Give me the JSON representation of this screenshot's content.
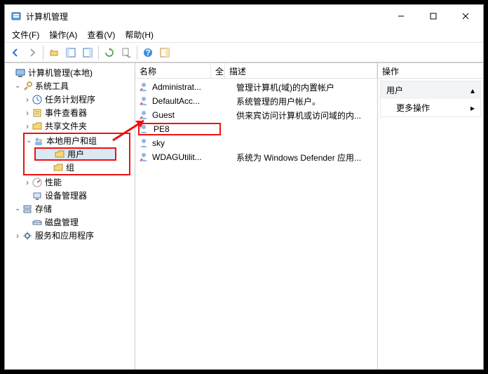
{
  "window": {
    "title": "计算机管理"
  },
  "menu": {
    "file": "文件(F)",
    "action": "操作(A)",
    "view": "查看(V)",
    "help": "帮助(H)"
  },
  "tree": {
    "root": "计算机管理(本地)",
    "system_tools": "系统工具",
    "task_scheduler": "任务计划程序",
    "event_viewer": "事件查看器",
    "shared_folders": "共享文件夹",
    "local_users_groups": "本地用户和组",
    "users": "用户",
    "groups": "组",
    "performance": "性能",
    "device_manager": "设备管理器",
    "storage": "存储",
    "disk_management": "磁盘管理",
    "services_apps": "服务和应用程序"
  },
  "list": {
    "col_name": "名称",
    "col_full": "全",
    "col_desc": "描述",
    "rows": [
      {
        "name": "Administrat...",
        "desc": "管理计算机(域)的内置帐户"
      },
      {
        "name": "DefaultAcc...",
        "desc": "系统管理的用户帐户。"
      },
      {
        "name": "Guest",
        "desc": "供来宾访问计算机或访问域的内..."
      },
      {
        "name": "PE8",
        "desc": ""
      },
      {
        "name": "sky",
        "desc": ""
      },
      {
        "name": "WDAGUtilit...",
        "desc": "系统为 Windows Defender 应用..."
      }
    ]
  },
  "actions": {
    "header": "操作",
    "section": "用户",
    "more": "更多操作"
  }
}
